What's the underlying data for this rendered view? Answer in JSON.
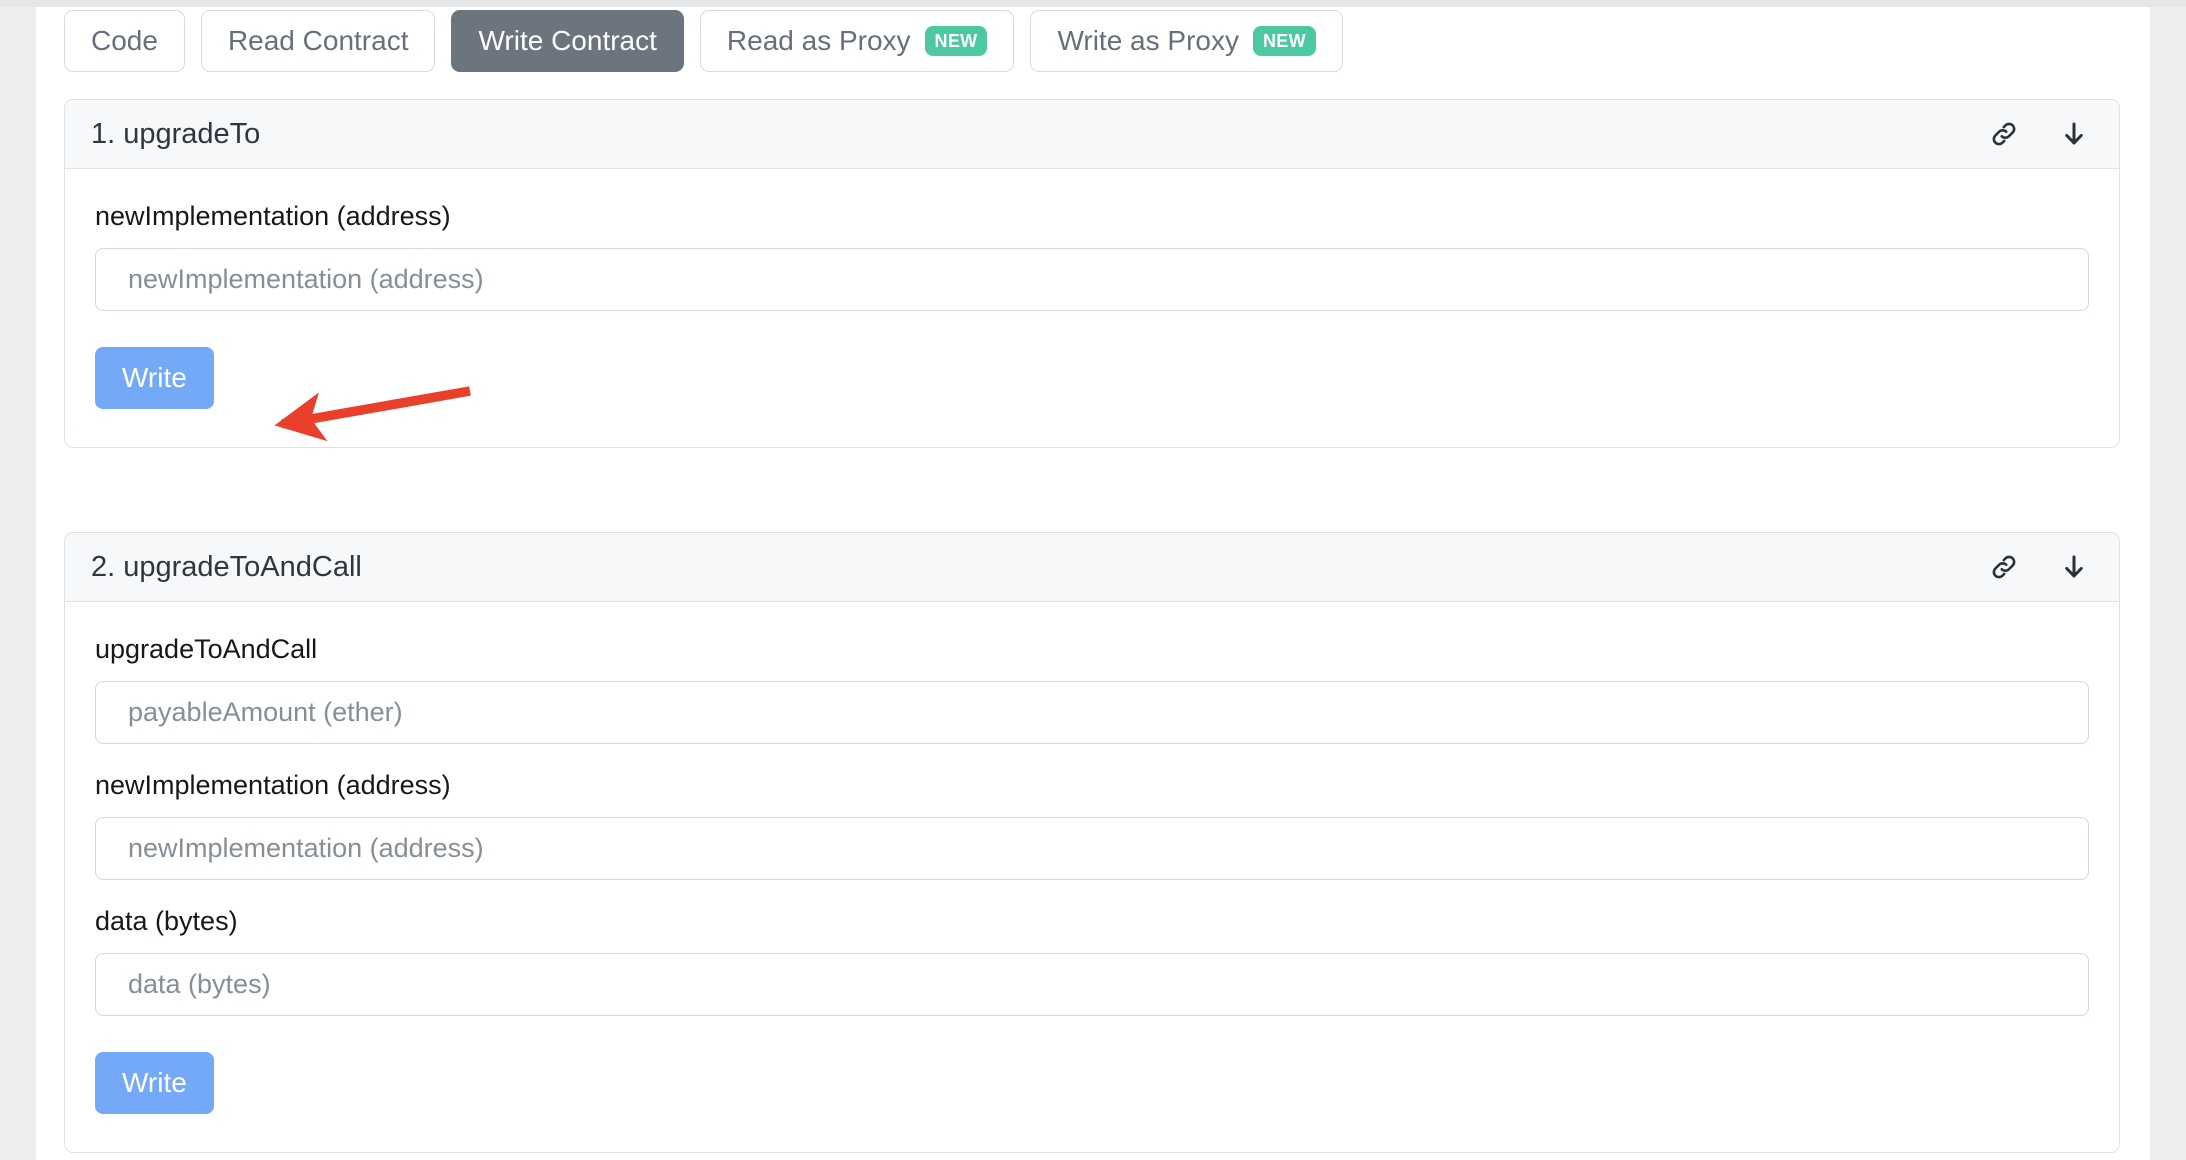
{
  "tabs": [
    {
      "label": "Code",
      "active": false,
      "badge": null
    },
    {
      "label": "Read Contract",
      "active": false,
      "badge": null
    },
    {
      "label": "Write Contract",
      "active": true,
      "badge": null
    },
    {
      "label": "Read as Proxy",
      "active": false,
      "badge": "NEW"
    },
    {
      "label": "Write as Proxy",
      "active": false,
      "badge": "NEW"
    }
  ],
  "functions": [
    {
      "title": "1. upgradeTo",
      "fields": [
        {
          "label": "newImplementation (address)",
          "placeholder": "newImplementation (address)",
          "value": ""
        }
      ],
      "submit_label": "Write"
    },
    {
      "title": "2. upgradeToAndCall",
      "fields": [
        {
          "label": "upgradeToAndCall",
          "placeholder": "payableAmount (ether)",
          "value": ""
        },
        {
          "label": "newImplementation (address)",
          "placeholder": "newImplementation (address)",
          "value": ""
        },
        {
          "label": "data (bytes)",
          "placeholder": "data (bytes)",
          "value": ""
        }
      ],
      "submit_label": "Write"
    }
  ],
  "icons": {
    "link": "link-icon",
    "download": "down-arrow-icon"
  },
  "annotation": {
    "type": "arrow",
    "color": "#e8402a",
    "points_to": "Write button of upgradeTo"
  },
  "colors": {
    "active_tab": "#6c757d",
    "badge_new": "#4cc8a3",
    "write_button": "#74a9f7",
    "annotation_arrow": "#e8402a"
  }
}
